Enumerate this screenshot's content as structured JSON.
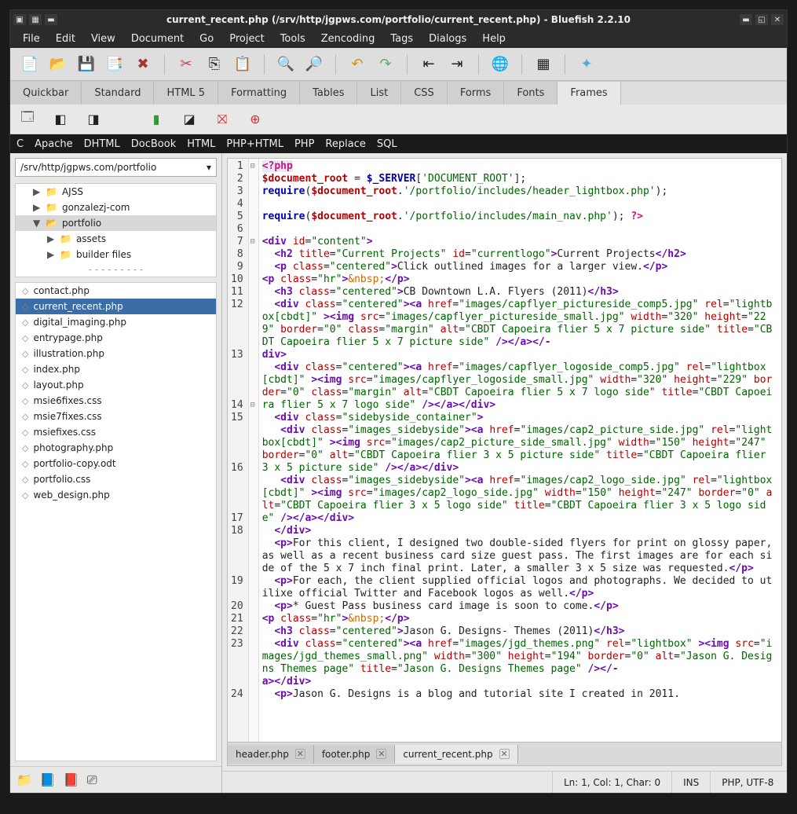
{
  "title": "current_recent.php (/srv/http/jgpws.com/portfolio/current_recent.php) - Bluefish 2.2.10",
  "menu": [
    "File",
    "Edit",
    "View",
    "Document",
    "Go",
    "Project",
    "Tools",
    "Zencoding",
    "Tags",
    "Dialogs",
    "Help"
  ],
  "tabs": [
    "Quickbar",
    "Standard",
    "HTML 5",
    "Formatting",
    "Tables",
    "List",
    "CSS",
    "Forms",
    "Fonts",
    "Frames"
  ],
  "active_tab": "Frames",
  "langbar": [
    "C",
    "Apache",
    "DHTML",
    "DocBook",
    "HTML",
    "PHP+HTML",
    "PHP",
    "Replace",
    "SQL"
  ],
  "path": "/srv/http/jgpws.com/portfolio",
  "tree": [
    {
      "label": "AJSS",
      "depth": 1,
      "expand": "▶"
    },
    {
      "label": "gonzalezj-com",
      "depth": 1,
      "expand": "▶"
    },
    {
      "label": "portfolio",
      "depth": 1,
      "expand": "▼",
      "sel": true
    },
    {
      "label": "assets",
      "depth": 2,
      "expand": "▶"
    },
    {
      "label": "builder files",
      "depth": 2,
      "expand": "▶"
    }
  ],
  "files": [
    {
      "name": "contact.php"
    },
    {
      "name": "current_recent.php",
      "sel": true
    },
    {
      "name": "digital_imaging.php"
    },
    {
      "name": "entrypage.php"
    },
    {
      "name": "illustration.php"
    },
    {
      "name": "index.php"
    },
    {
      "name": "layout.php"
    },
    {
      "name": "msie6fixes.css"
    },
    {
      "name": "msie7fixes.css"
    },
    {
      "name": "msiefixes.css"
    },
    {
      "name": "photography.php"
    },
    {
      "name": "portfolio-copy.odt"
    },
    {
      "name": "portfolio.css"
    },
    {
      "name": "web_design.php"
    }
  ],
  "filetabs": [
    {
      "name": "header.php"
    },
    {
      "name": "footer.php"
    },
    {
      "name": "current_recent.php",
      "active": true
    }
  ],
  "status": {
    "pos": "Ln: 1, Col: 1, Char: 0",
    "ins": "INS",
    "enc": "PHP, UTF-8"
  },
  "gutter": " 1\n 2\n 3\n 4\n 5\n 6\n 7\n 8\n 9\n10\n11\n12\n\n\n\n13\n\n\n\n14\n15\n\n\n\n16\n\n\n\n17\n18\n\n\n\n19\n\n20\n21\n22\n23\n\n\n\n24",
  "fold": "⊟\n\n\n\n\n\n⊟\n\n\n\n\n\n\n\n\n\n\n\n\n⊟\n\n\n\n\n\n\n\n\n\n\n\n\n\n\n\n\n\n\n\n\n\n\n"
}
